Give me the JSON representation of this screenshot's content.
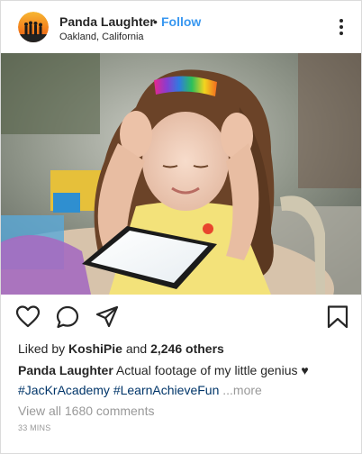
{
  "header": {
    "username": "Panda Laughter",
    "separator": "•",
    "follow_label": "Follow",
    "location": "Oakland, California"
  },
  "icons": {
    "options": "more-options-icon",
    "like": "heart-icon",
    "comment": "comment-icon",
    "share": "share-icon",
    "save": "bookmark-icon"
  },
  "colors": {
    "follow": "#3897f0",
    "hashtag": "#003569",
    "muted": "#999999",
    "text": "#262626"
  },
  "likes": {
    "prefix": "Liked by",
    "user": "KoshiPie",
    "middle": "and",
    "others": "2,246 others"
  },
  "caption": {
    "username": "Panda Laughter",
    "text": "Actual footage of my little genius ♥"
  },
  "hashtags": [
    "#JacKrAcademy",
    "#LearnAchieveFun"
  ],
  "more_label": "...more",
  "view_comments": "View all 1680 comments",
  "timestamp": "33 MINS"
}
